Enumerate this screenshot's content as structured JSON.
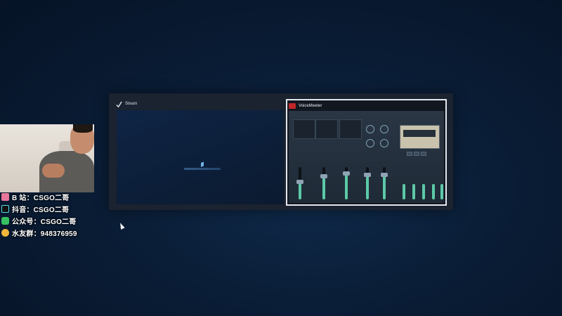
{
  "switcher": {
    "windows": [
      {
        "title": "Steam",
        "icon": "steam-icon",
        "selected": false
      },
      {
        "title": "VoiceMeeter",
        "icon": "voicemeeter-icon",
        "selected": true
      }
    ]
  },
  "social": {
    "rows": [
      {
        "icon": "bilibili-icon",
        "text": "B 站：CSGO二哥"
      },
      {
        "icon": "douyin-icon",
        "text": "抖音：CSGO二哥"
      },
      {
        "icon": "wechat-icon",
        "text": "公众号：CSGO二哥"
      },
      {
        "icon": "qq-group-icon",
        "text": "水友群：948376959"
      }
    ]
  },
  "colors": {
    "background": "#0a1d36",
    "selection_border": "#e4e8ee",
    "fader_green": "#5cc9a7"
  }
}
